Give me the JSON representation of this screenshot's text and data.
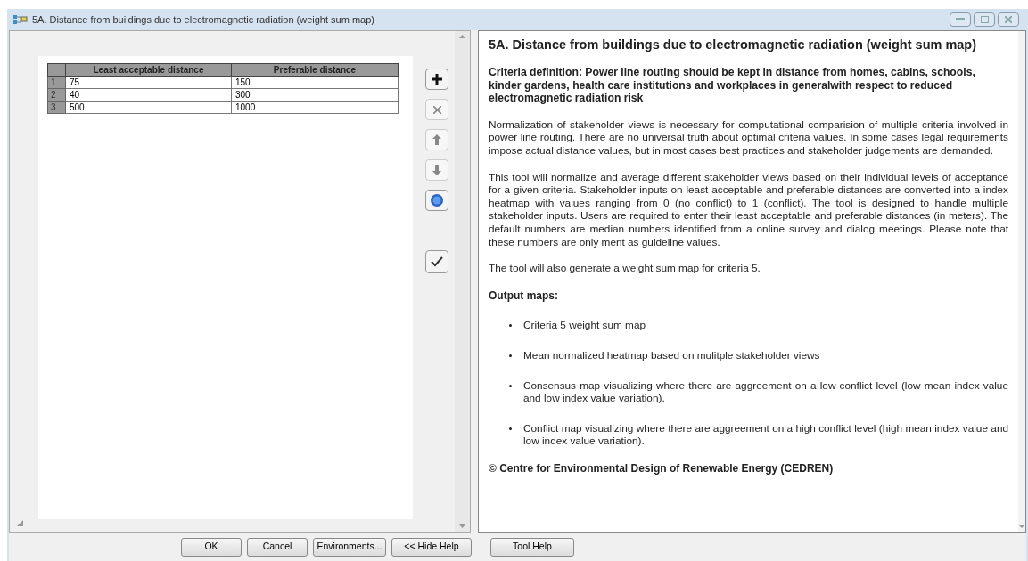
{
  "window": {
    "title": "5A. Distance from buildings due to electromagnetic radiation (weight sum map)"
  },
  "table": {
    "columns": [
      "Least acceptable distance",
      "Preferable distance"
    ],
    "rows": [
      {
        "number": "1",
        "cells": [
          "75",
          "150"
        ]
      },
      {
        "number": "2",
        "cells": [
          "40",
          "300"
        ]
      },
      {
        "number": "3",
        "cells": [
          "500",
          "1000"
        ]
      }
    ]
  },
  "help": {
    "title": "5A. Distance from buildings due to electromagnetic radiation (weight sum map)",
    "definition": "Criteria definition: Power line routing should be kept in distance from homes, cabins, schools, kinder gardens, health care institutions and workplaces in generalwith respect to reduced electromagnetic radiation risk",
    "paragraphs": [
      "Normalization of stakeholder views is necessary for computational comparision of multiple criteria involved in power line routing. There are no universal truth about optimal criteria values. In some cases legal requirements impose actual distance values, but in most cases best practices and stakeholder judgements are demanded.",
      "This tool will normalize and average different stakeholder views based on their individual levels of acceptance for a given criteria. Stakeholder inputs on least acceptable and preferable distances are converted into a index heatmap with values ranging from 0 (no conflict) to 1 (conflict). The tool is designed to handle multiple stakeholder inputs. Users are required to enter their least acceptable and preferable distances (in meters). The default numbers are median numbers identified from a online survey and dialog meetings. Please note that these numbers are only ment as guideline values.",
      "The tool will also generate a weight sum map for criteria 5."
    ],
    "output_heading": "Output maps:",
    "bullets": [
      "Criteria 5 weight sum map",
      "Mean normalized heatmap based on mulitple stakeholder views",
      "Consensus map visualizing where there are aggreement on a low conflict level (low mean index value and low index value variation).",
      "Conflict map visualizing where there are aggreement on a high conflict level (high mean index value and low index value variation)."
    ],
    "copyright": "© Centre for Environmental Design of Renewable Energy (CEDREN)"
  },
  "buttons": [
    "OK",
    "Cancel",
    "Environments...",
    "<< Hide Help"
  ],
  "help_button": "Tool Help"
}
